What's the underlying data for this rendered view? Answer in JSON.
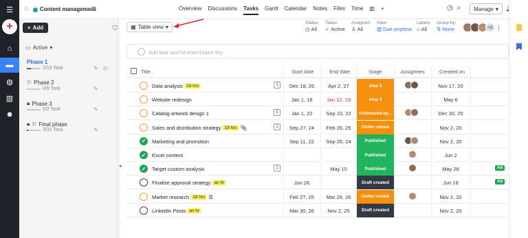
{
  "colors": {
    "rail": "#1f2329",
    "accent_blue": "#3b82f6",
    "brand_red": "#e0262f",
    "orange": "#f0a030",
    "green": "#22a559",
    "dark_stage": "#343a45"
  },
  "topbar": {
    "project_title": "Content management",
    "nav": [
      "Overview",
      "Discussions",
      "Tasks",
      "Gantt",
      "Calendar",
      "Notes",
      "Files",
      "Time"
    ],
    "active_nav": "Tasks",
    "manage_label": "Manage"
  },
  "sidebar": {
    "add_label": "Add",
    "active_filter": "Active",
    "phases": [
      {
        "name": "Phase 1",
        "count": "3/10 Task",
        "progress": 0.3,
        "icon": "none",
        "selected": true
      },
      {
        "name": "Phase 2",
        "count": "0/8 Task",
        "progress": 0,
        "icon": "flag-icon",
        "selected": false
      },
      {
        "name": "Phase 3",
        "count": "0/2 Task",
        "progress": 0,
        "icon": "lock-icon",
        "selected": false
      },
      {
        "name": "Final phase",
        "count": "3/31 Task",
        "progress": 0.1,
        "icon": "lock-flag-icon",
        "selected": false
      }
    ]
  },
  "toolbar": {
    "view_label": "Table view",
    "filters": [
      {
        "label": "Status:",
        "value": "All",
        "icon": "clock-icon",
        "blue": false
      },
      {
        "label": "Tasks:",
        "value": "Active",
        "icon": "check-icon",
        "blue": false
      },
      {
        "label": "Assigned:",
        "value": "All",
        "icon": "user-icon",
        "blue": false
      },
      {
        "label": "View:",
        "value": "Due anytime",
        "icon": "chart-icon",
        "blue": true
      },
      {
        "label": "Labels:",
        "value": "All",
        "icon": "tag-icon",
        "blue": false
      },
      {
        "label": "Group by:",
        "value": "None",
        "icon": "hierarchy-icon",
        "blue": true
      }
    ],
    "more_avatars": "+2"
  },
  "add_task": {
    "placeholder": "Add task and hit enter/return key"
  },
  "table": {
    "headers": {
      "title": "Title",
      "start": "Start date",
      "end": "End date",
      "stage": "Stage",
      "assignees": "Assignees",
      "created": "Created on"
    },
    "rows": [
      {
        "name": "Data analysis",
        "tag": "19 hrs",
        "sub": "1",
        "status": "prog",
        "start": "Dec 18, 26",
        "end": "Apr 2, 27",
        "end_red": false,
        "stage": "step 3",
        "stage_color": "#f5900f",
        "assignees": 2,
        "created": "Nov 17, 20",
        "extra": ""
      },
      {
        "name": "Website redesign",
        "tag": "",
        "sub": "",
        "status": "prog",
        "start": "Jan 1, 19",
        "end": "Jan 12, 19",
        "end_red": true,
        "stage": "step 3",
        "stage_color": "#f5900f",
        "assignees": 0,
        "created": "May 6",
        "extra": ""
      },
      {
        "name": "Catalog artwork design 1",
        "tag": "",
        "sub": "5",
        "status": "prog",
        "start": "Jan 1, 22",
        "end": "Sep 10, 22",
        "end_red": false,
        "stage": "Addressed by...",
        "stage_color": "#f5900f",
        "assignees": 2,
        "created": "Dec 30, 20",
        "extra": ""
      },
      {
        "name": "Sales and distribution strategy",
        "tag": "19 hrs",
        "sub": "1",
        "status": "prog",
        "start": "Sep 27, 24",
        "end": "Feb 26, 25",
        "end_red": false,
        "stage": "Under review",
        "stage_color": "#f5900f",
        "assignees": 0,
        "created": "Nov 2, 20",
        "extra": ""
      },
      {
        "name": "Marketing and promotion",
        "tag": "",
        "sub": "",
        "status": "done",
        "start": "Sep 11, 22",
        "end": "Sep 26, 24",
        "end_red": false,
        "stage": "Published",
        "stage_color": "#22b35e",
        "assignees": 2,
        "created": "Nov 2, 20",
        "extra": ""
      },
      {
        "name": "Excel content",
        "tag": "",
        "sub": "",
        "status": "done",
        "start": "",
        "end": "",
        "end_red": false,
        "stage": "Published",
        "stage_color": "#22b35e",
        "assignees": 1,
        "created": "Jun 2",
        "extra": ""
      },
      {
        "name": "Target custom analysis",
        "tag": "",
        "sub": "1",
        "status": "done",
        "start": "",
        "end": "May 10",
        "end_red": false,
        "stage": "Published",
        "stage_color": "#22b35e",
        "assignees": 1,
        "created": "May 26",
        "extra": "Ad"
      },
      {
        "name": "Finalise approval strategy",
        "tag": "an hr",
        "sub": "",
        "status": "open",
        "start": "Jun 26",
        "end": "",
        "end_red": false,
        "stage": "Draft created",
        "stage_color": "#343a45",
        "assignees": 0,
        "created": "Jun 16",
        "extra": "Ad"
      },
      {
        "name": "Market research",
        "tag": "19 hrs",
        "sub": "",
        "status": "prog",
        "start": "Feb 27, 25",
        "end": "Mar 29, 26",
        "end_red": false,
        "stage": "Under review",
        "stage_color": "#f5900f",
        "assignees": 1,
        "created": "Nov 2, 20",
        "extra": ""
      },
      {
        "name": "LinkedIn Posts",
        "tag": "an hr",
        "sub": "",
        "status": "open",
        "start": "Mar 30, 26",
        "end": "Nov 2, 25",
        "end_red": false,
        "stage": "Draft created",
        "stage_color": "#343a45",
        "assignees": 0,
        "created": "Nov 2, 20",
        "extra": ""
      }
    ]
  }
}
